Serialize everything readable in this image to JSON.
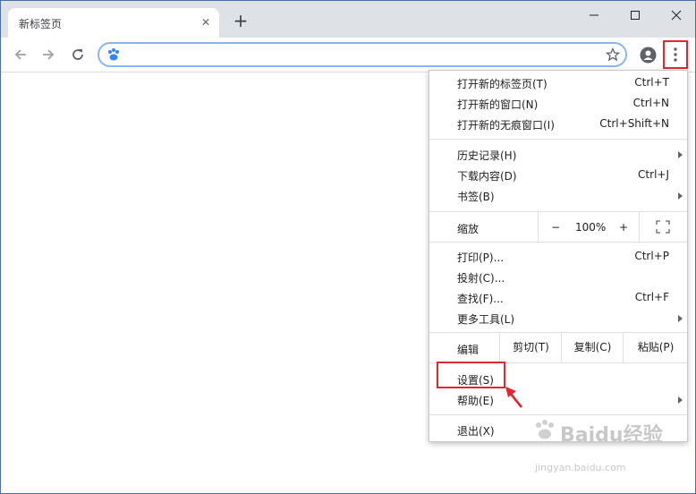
{
  "tab": {
    "title": "新标签页",
    "close_symbol": "✕"
  },
  "newtab_symbol": "+",
  "address_bar": {
    "value": ""
  },
  "menu": {
    "group1": [
      {
        "label": "打开新的标签页(T)",
        "shortcut": "Ctrl+T"
      },
      {
        "label": "打开新的窗口(N)",
        "shortcut": "Ctrl+N"
      },
      {
        "label": "打开新的无痕窗口(I)",
        "shortcut": "Ctrl+Shift+N"
      }
    ],
    "group2": [
      {
        "label": "历史记录(H)",
        "shortcut": ""
      },
      {
        "label": "下载内容(D)",
        "shortcut": "Ctrl+J"
      },
      {
        "label": "书签(B)",
        "shortcut": ""
      }
    ],
    "zoom": {
      "label": "缩放",
      "minus": "−",
      "value": "100%",
      "plus": "+"
    },
    "group3": [
      {
        "label": "打印(P)...",
        "shortcut": "Ctrl+P"
      },
      {
        "label": "投射(C)...",
        "shortcut": ""
      },
      {
        "label": "查找(F)...",
        "shortcut": "Ctrl+F"
      },
      {
        "label": "更多工具(L)",
        "shortcut": ""
      }
    ],
    "edit": {
      "label": "编辑",
      "cut": "剪切(T)",
      "copy": "复制(C)",
      "paste": "粘贴(P)"
    },
    "group4": [
      {
        "label": "设置(S)",
        "shortcut": ""
      },
      {
        "label": "帮助(E)",
        "shortcut": ""
      }
    ],
    "exit": {
      "label": "退出(X)"
    }
  },
  "watermark": {
    "brand": "Baidu经验",
    "url": "jingyan.baidu.com"
  },
  "colors": {
    "highlight": "#e0282e",
    "omnibox_border": "#8ab4f8",
    "titlebar": "#dee1e6"
  }
}
